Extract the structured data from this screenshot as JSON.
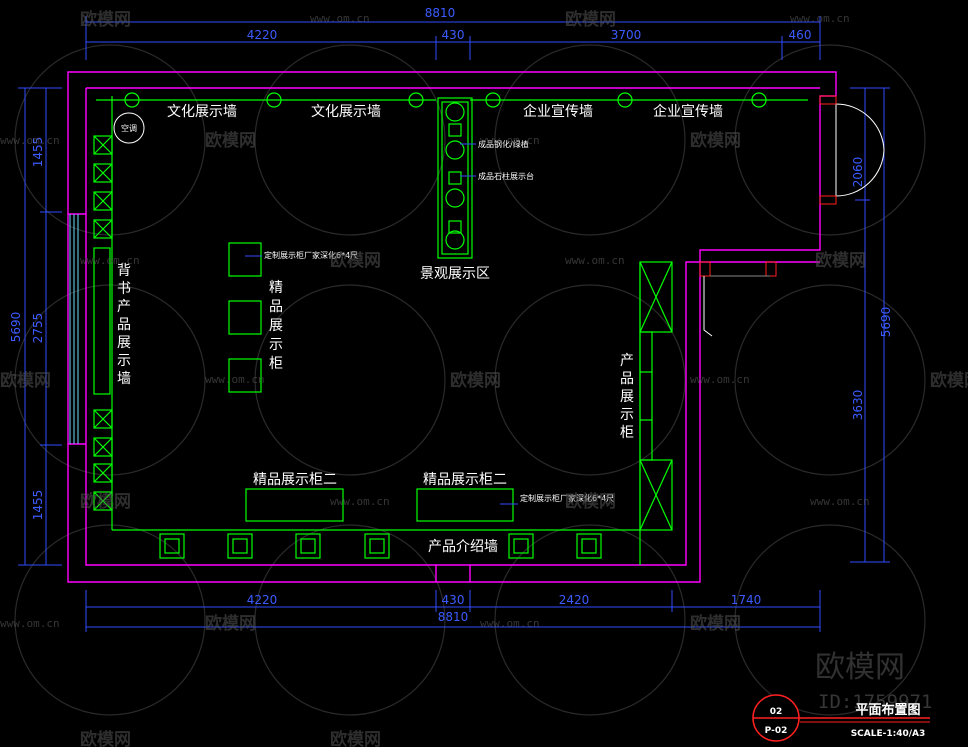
{
  "dimensions": {
    "top_total": "8810",
    "top_segments": [
      "4220",
      "430",
      "3700",
      "460"
    ],
    "bottom_total": "8810",
    "bottom_segments": [
      "4220",
      "430",
      "2420",
      "1740"
    ],
    "left_total": "5690",
    "left_segments": [
      "1455",
      "2755",
      "1455"
    ],
    "right_total": "5690",
    "right_segments": [
      "2060",
      "3630"
    ]
  },
  "labels": {
    "culture_wall_1": "文化展示墙",
    "culture_wall_2": "文化展示墙",
    "corp_wall_1": "企业宣传墙",
    "corp_wall_2": "企业宣传墙",
    "ac": "空调",
    "landscape_area": "景观展示区",
    "landscape_note_1": "成品钢化/绿植",
    "landscape_note_2": "成品石柱展示台",
    "boutique_cabinet": [
      "精",
      "品",
      "展",
      "示",
      "柜"
    ],
    "boutique_note": "定制展示柜厂家深化6*4尺",
    "back_wall": [
      "背",
      "书",
      "产",
      "品",
      "展",
      "示",
      "墙"
    ],
    "product_cabinet": [
      "产",
      "品",
      "展",
      "示",
      "柜"
    ],
    "boutique_2_left": "精品展示柜二",
    "boutique_2_right": "精品展示柜二",
    "boutique_2_note": "定制展示柜厂家深化6*4尺",
    "product_intro_wall": "产品介绍墙"
  },
  "title_block": {
    "sheet_no": "02",
    "page": "P-02",
    "title": "平面布置图",
    "scale": "SCALE-1:40/A3"
  },
  "watermark": {
    "brand": "欧模网",
    "url": "www.om.cn",
    "id": "ID:1759971"
  },
  "colors": {
    "wall": "#ff00ff",
    "furniture": "#00ff00",
    "dimension": "#2f4cff",
    "text": "#ffffff",
    "red": "#ff2020"
  }
}
